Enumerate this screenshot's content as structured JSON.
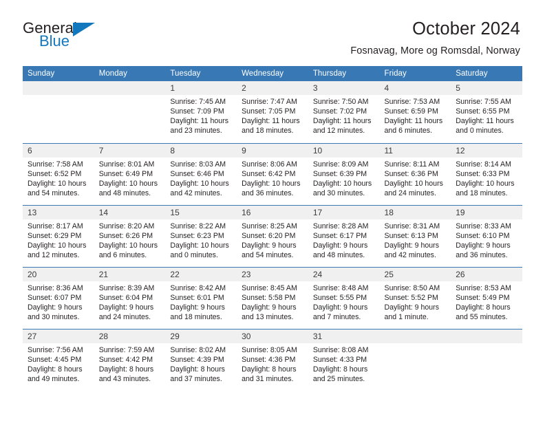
{
  "logo": {
    "word1": "General",
    "word2": "Blue",
    "accent_color": "#1278be"
  },
  "header": {
    "title": "October 2024",
    "subtitle": "Fosnavag, More og Romsdal, Norway"
  },
  "theme": {
    "header_row_bg": "#3878b4",
    "daynum_bg": "#f0f0f0",
    "text": "#231f20"
  },
  "calendar": {
    "weekdays": [
      "Sunday",
      "Monday",
      "Tuesday",
      "Wednesday",
      "Thursday",
      "Friday",
      "Saturday"
    ],
    "weeks": [
      [
        {
          "day": "",
          "lines": []
        },
        {
          "day": "",
          "lines": []
        },
        {
          "day": "1",
          "lines": [
            "Sunrise: 7:45 AM",
            "Sunset: 7:09 PM",
            "Daylight: 11 hours",
            "and 23 minutes."
          ]
        },
        {
          "day": "2",
          "lines": [
            "Sunrise: 7:47 AM",
            "Sunset: 7:05 PM",
            "Daylight: 11 hours",
            "and 18 minutes."
          ]
        },
        {
          "day": "3",
          "lines": [
            "Sunrise: 7:50 AM",
            "Sunset: 7:02 PM",
            "Daylight: 11 hours",
            "and 12 minutes."
          ]
        },
        {
          "day": "4",
          "lines": [
            "Sunrise: 7:53 AM",
            "Sunset: 6:59 PM",
            "Daylight: 11 hours",
            "and 6 minutes."
          ]
        },
        {
          "day": "5",
          "lines": [
            "Sunrise: 7:55 AM",
            "Sunset: 6:55 PM",
            "Daylight: 11 hours",
            "and 0 minutes."
          ]
        }
      ],
      [
        {
          "day": "6",
          "lines": [
            "Sunrise: 7:58 AM",
            "Sunset: 6:52 PM",
            "Daylight: 10 hours",
            "and 54 minutes."
          ]
        },
        {
          "day": "7",
          "lines": [
            "Sunrise: 8:01 AM",
            "Sunset: 6:49 PM",
            "Daylight: 10 hours",
            "and 48 minutes."
          ]
        },
        {
          "day": "8",
          "lines": [
            "Sunrise: 8:03 AM",
            "Sunset: 6:46 PM",
            "Daylight: 10 hours",
            "and 42 minutes."
          ]
        },
        {
          "day": "9",
          "lines": [
            "Sunrise: 8:06 AM",
            "Sunset: 6:42 PM",
            "Daylight: 10 hours",
            "and 36 minutes."
          ]
        },
        {
          "day": "10",
          "lines": [
            "Sunrise: 8:09 AM",
            "Sunset: 6:39 PM",
            "Daylight: 10 hours",
            "and 30 minutes."
          ]
        },
        {
          "day": "11",
          "lines": [
            "Sunrise: 8:11 AM",
            "Sunset: 6:36 PM",
            "Daylight: 10 hours",
            "and 24 minutes."
          ]
        },
        {
          "day": "12",
          "lines": [
            "Sunrise: 8:14 AM",
            "Sunset: 6:33 PM",
            "Daylight: 10 hours",
            "and 18 minutes."
          ]
        }
      ],
      [
        {
          "day": "13",
          "lines": [
            "Sunrise: 8:17 AM",
            "Sunset: 6:29 PM",
            "Daylight: 10 hours",
            "and 12 minutes."
          ]
        },
        {
          "day": "14",
          "lines": [
            "Sunrise: 8:20 AM",
            "Sunset: 6:26 PM",
            "Daylight: 10 hours",
            "and 6 minutes."
          ]
        },
        {
          "day": "15",
          "lines": [
            "Sunrise: 8:22 AM",
            "Sunset: 6:23 PM",
            "Daylight: 10 hours",
            "and 0 minutes."
          ]
        },
        {
          "day": "16",
          "lines": [
            "Sunrise: 8:25 AM",
            "Sunset: 6:20 PM",
            "Daylight: 9 hours",
            "and 54 minutes."
          ]
        },
        {
          "day": "17",
          "lines": [
            "Sunrise: 8:28 AM",
            "Sunset: 6:17 PM",
            "Daylight: 9 hours",
            "and 48 minutes."
          ]
        },
        {
          "day": "18",
          "lines": [
            "Sunrise: 8:31 AM",
            "Sunset: 6:13 PM",
            "Daylight: 9 hours",
            "and 42 minutes."
          ]
        },
        {
          "day": "19",
          "lines": [
            "Sunrise: 8:33 AM",
            "Sunset: 6:10 PM",
            "Daylight: 9 hours",
            "and 36 minutes."
          ]
        }
      ],
      [
        {
          "day": "20",
          "lines": [
            "Sunrise: 8:36 AM",
            "Sunset: 6:07 PM",
            "Daylight: 9 hours",
            "and 30 minutes."
          ]
        },
        {
          "day": "21",
          "lines": [
            "Sunrise: 8:39 AM",
            "Sunset: 6:04 PM",
            "Daylight: 9 hours",
            "and 24 minutes."
          ]
        },
        {
          "day": "22",
          "lines": [
            "Sunrise: 8:42 AM",
            "Sunset: 6:01 PM",
            "Daylight: 9 hours",
            "and 18 minutes."
          ]
        },
        {
          "day": "23",
          "lines": [
            "Sunrise: 8:45 AM",
            "Sunset: 5:58 PM",
            "Daylight: 9 hours",
            "and 13 minutes."
          ]
        },
        {
          "day": "24",
          "lines": [
            "Sunrise: 8:48 AM",
            "Sunset: 5:55 PM",
            "Daylight: 9 hours",
            "and 7 minutes."
          ]
        },
        {
          "day": "25",
          "lines": [
            "Sunrise: 8:50 AM",
            "Sunset: 5:52 PM",
            "Daylight: 9 hours",
            "and 1 minute."
          ]
        },
        {
          "day": "26",
          "lines": [
            "Sunrise: 8:53 AM",
            "Sunset: 5:49 PM",
            "Daylight: 8 hours",
            "and 55 minutes."
          ]
        }
      ],
      [
        {
          "day": "27",
          "lines": [
            "Sunrise: 7:56 AM",
            "Sunset: 4:45 PM",
            "Daylight: 8 hours",
            "and 49 minutes."
          ]
        },
        {
          "day": "28",
          "lines": [
            "Sunrise: 7:59 AM",
            "Sunset: 4:42 PM",
            "Daylight: 8 hours",
            "and 43 minutes."
          ]
        },
        {
          "day": "29",
          "lines": [
            "Sunrise: 8:02 AM",
            "Sunset: 4:39 PM",
            "Daylight: 8 hours",
            "and 37 minutes."
          ]
        },
        {
          "day": "30",
          "lines": [
            "Sunrise: 8:05 AM",
            "Sunset: 4:36 PM",
            "Daylight: 8 hours",
            "and 31 minutes."
          ]
        },
        {
          "day": "31",
          "lines": [
            "Sunrise: 8:08 AM",
            "Sunset: 4:33 PM",
            "Daylight: 8 hours",
            "and 25 minutes."
          ]
        },
        {
          "day": "",
          "lines": []
        },
        {
          "day": "",
          "lines": []
        }
      ]
    ]
  }
}
